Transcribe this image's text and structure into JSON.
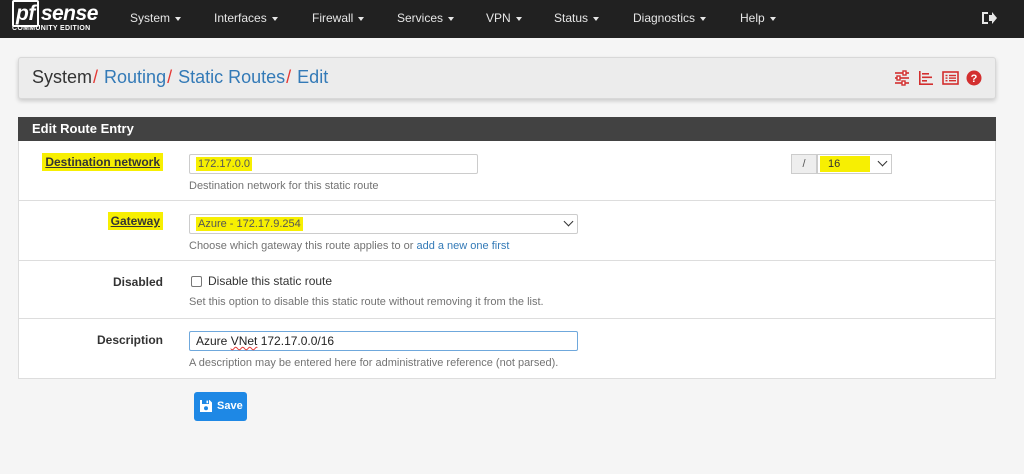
{
  "brand": {
    "name": "sense",
    "name_prefix": "pf",
    "edition": "COMMUNITY EDITION"
  },
  "nav": {
    "items": [
      {
        "label": "System"
      },
      {
        "label": "Interfaces"
      },
      {
        "label": "Firewall"
      },
      {
        "label": "Services"
      },
      {
        "label": "VPN"
      },
      {
        "label": "Status"
      },
      {
        "label": "Diagnostics"
      },
      {
        "label": "Help"
      }
    ],
    "logout_icon": "logout-icon"
  },
  "breadcrumb": {
    "items": [
      "System",
      "Routing",
      "Static Routes",
      "Edit"
    ],
    "separator": "/",
    "icons": [
      "sliders-icon",
      "bar-chart-icon",
      "list-icon",
      "help-icon"
    ]
  },
  "panel": {
    "title": "Edit Route Entry"
  },
  "form": {
    "destination": {
      "label": "Destination network",
      "value": "172.17.0.0",
      "help": "Destination network for this static route",
      "slash": "/",
      "mask": "16"
    },
    "gateway": {
      "label": "Gateway",
      "value": "Azure - 172.17.9.254",
      "help": "Choose which gateway this route applies to or",
      "help_link": "add a new one first"
    },
    "disabled": {
      "label": "Disabled",
      "checkbox_label": "Disable this static route",
      "checked": false,
      "help": "Set this option to disable this static route without removing it from the list."
    },
    "description": {
      "label": "Description",
      "value_prefix": "Azure ",
      "value_misspelled": "VNet",
      "value_suffix": " 172.17.0.0/16",
      "help": "A description may be entered here for administrative reference (not parsed)."
    }
  },
  "save_button": {
    "label": "Save"
  },
  "colors": {
    "accent": "#1e88e5",
    "link": "#337ab7",
    "highlight": "#f7ef02",
    "danger": "#e53935",
    "navbar": "#212121",
    "panel_header": "#424242"
  }
}
